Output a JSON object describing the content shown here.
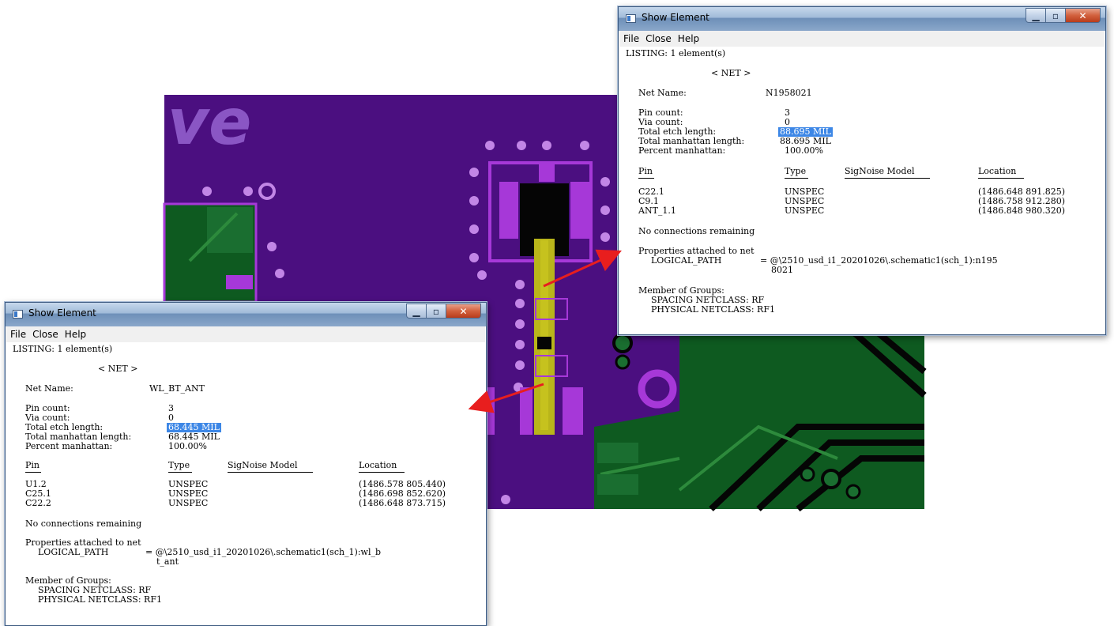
{
  "windows": {
    "right": {
      "title": "Show Element",
      "menu": [
        "File",
        "Close",
        "Help"
      ],
      "listing_header": "LISTING: 1 element(s)",
      "section_title": "< NET >",
      "net_name_label": "Net Name:",
      "net_name_value": "N1958021",
      "stats": [
        {
          "label": "Pin count:",
          "value": "3"
        },
        {
          "label": "Via count:",
          "value": "0"
        },
        {
          "label": "Total etch length:",
          "value": "88.695 MIL"
        },
        {
          "label": "Total manhattan length:",
          "value": "88.695 MIL"
        },
        {
          "label": "Percent manhattan:",
          "value": "100.00%"
        }
      ],
      "table_headers": {
        "pin": "Pin",
        "type": "Type",
        "model": "SigNoise Model",
        "location": "Location"
      },
      "rows": [
        {
          "pin": "C22.1",
          "type": "UNSPEC",
          "location": "(1486.648 891.825)"
        },
        {
          "pin": "C9.1",
          "type": "UNSPEC",
          "location": "(1486.758 912.280)"
        },
        {
          "pin": "ANT_1.1",
          "type": "UNSPEC",
          "location": "(1486.848 980.320)"
        }
      ],
      "no_connections": "No connections remaining",
      "props_header": "Properties attached to net",
      "logical_path_label": "LOGICAL_PATH",
      "logical_path_value": "= @\\2510_usd_i1_20201026\\.schematic1(sch_1):n195",
      "logical_path_cont": "8021",
      "groups_header": "Member of Groups:",
      "spacing_netclass": "SPACING NETCLASS: RF",
      "physical_netclass": "PHYSICAL NETCLASS: RF1"
    },
    "left": {
      "title": "Show Element",
      "menu": [
        "File",
        "Close",
        "Help"
      ],
      "listing_header": "LISTING: 1 element(s)",
      "section_title": "< NET >",
      "net_name_label": "Net Name:",
      "net_name_value": "WL_BT_ANT",
      "stats": [
        {
          "label": "Pin count:",
          "value": "3"
        },
        {
          "label": "Via count:",
          "value": "0"
        },
        {
          "label": "Total etch length:",
          "value": "68.445 MIL"
        },
        {
          "label": "Total manhattan length:",
          "value": "68.445 MIL"
        },
        {
          "label": "Percent manhattan:",
          "value": "100.00%"
        }
      ],
      "table_headers": {
        "pin": "Pin",
        "type": "Type",
        "model": "SigNoise Model",
        "location": "Location"
      },
      "rows": [
        {
          "pin": "U1.2",
          "type": "UNSPEC",
          "location": "(1486.578 805.440)"
        },
        {
          "pin": "C25.1",
          "type": "UNSPEC",
          "location": "(1486.698 852.620)"
        },
        {
          "pin": "C22.2",
          "type": "UNSPEC",
          "location": "(1486.648 873.715)"
        }
      ],
      "no_connections": "No connections remaining",
      "props_header": "Properties attached to net",
      "logical_path_label": "LOGICAL_PATH",
      "logical_path_value": "= @\\2510_usd_i1_20201026\\.schematic1(sch_1):wl_b",
      "logical_path_cont": "t_ant",
      "groups_header": "Member of Groups:",
      "spacing_netclass": "SPACING NETCLASS: RF",
      "physical_netclass": "PHYSICAL NETCLASS: RF1"
    }
  },
  "pcb": {
    "logo_text": "ve",
    "colors": {
      "board": "#4b0f80",
      "copper_green": "#0e5a20",
      "pad_magenta": "#a638d8",
      "via_light": "#c286e6",
      "trace_yellow": "#b9b51a",
      "arrow": "#e81e1e",
      "highlight": "#3d87e6"
    }
  }
}
